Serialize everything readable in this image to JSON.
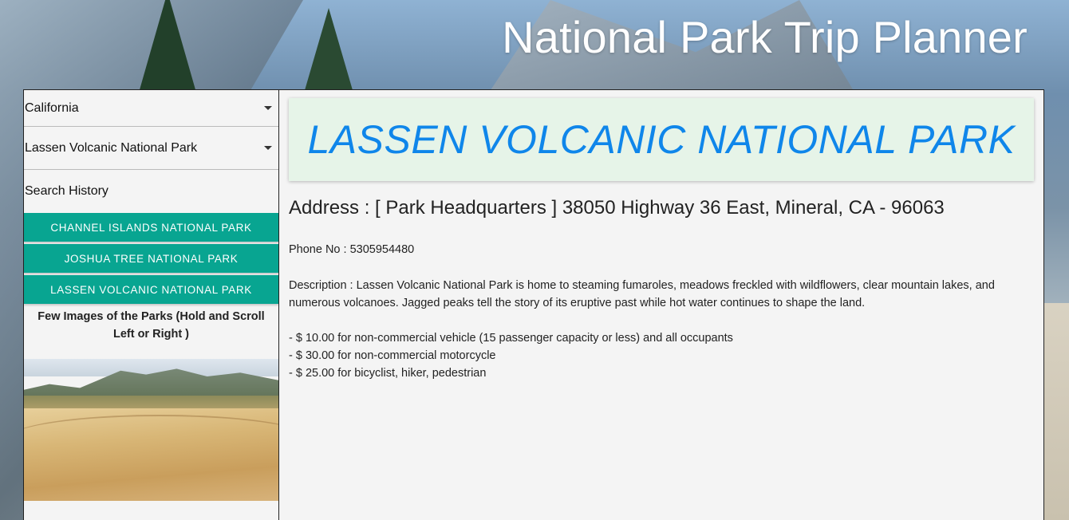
{
  "app": {
    "title": "National Park Trip Planner"
  },
  "sidebar": {
    "state_select": {
      "value": "California"
    },
    "park_select": {
      "value": "Lassen Volcanic National Park"
    },
    "history_label": "Search History",
    "history_items": [
      {
        "label": "CHANNEL ISLANDS NATIONAL PARK"
      },
      {
        "label": "JOSHUA TREE NATIONAL PARK"
      },
      {
        "label": "LASSEN VOLCANIC NATIONAL PARK"
      }
    ],
    "images_caption": "Few Images of the Parks (Hold and Scroll Left or Right )"
  },
  "park": {
    "name": "LASSEN VOLCANIC NATIONAL PARK",
    "address": "Address : [ Park Headquarters ] 38050 Highway 36 East, Mineral, CA - 96063",
    "phone": "Phone No : 5305954480",
    "description": "Description : Lassen Volcanic National Park is home to steaming fumaroles, meadows freckled with wildflowers, clear mountain lakes, and numerous volcanoes. Jagged peaks tell the story of its eruptive past while hot water continues to shape the land.",
    "fees": [
      "- $ 10.00 for non-commercial vehicle (15 passenger capacity or less) and all occupants",
      "- $ 30.00 for non-commercial motorcycle",
      "- $ 25.00 for bicyclist, hiker, pedestrian"
    ]
  },
  "colors": {
    "accent_button": "#08a591",
    "park_title": "#0f86ea",
    "header_bg": "#e6f4e8"
  }
}
